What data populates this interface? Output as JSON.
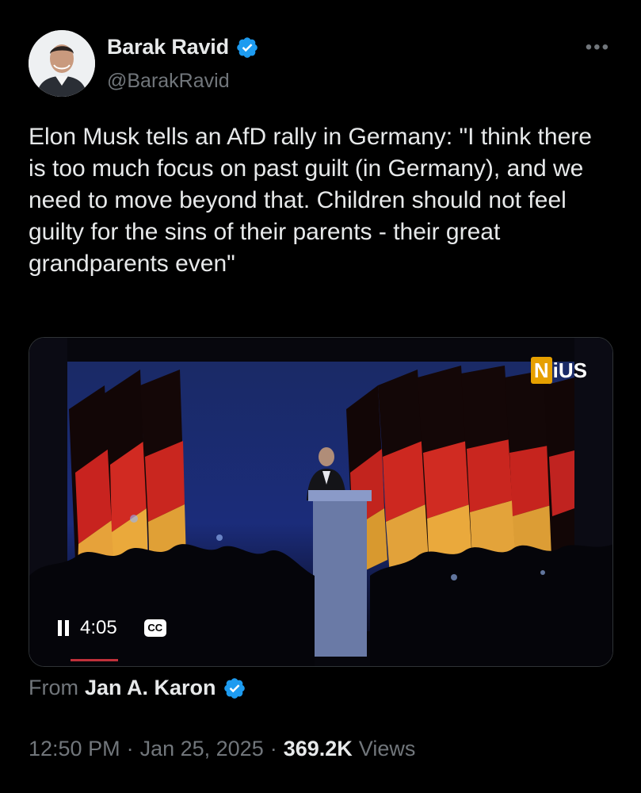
{
  "author": {
    "display_name": "Barak Ravid",
    "handle": "@BarakRavid",
    "verified": true
  },
  "more_icon": "more-horizontal-icon",
  "tweet": {
    "text": "Elon Musk tells an AfD rally in Germany: \"I think there is too much focus on past guilt (in Germany), and we need to move beyond that. Children should not feel guilty for the sins of their parents - their great grandparents even\""
  },
  "video": {
    "watermark_n": "N",
    "watermark_rest": "iUS",
    "state": "playing",
    "time": "4:05",
    "cc_label": "CC"
  },
  "source": {
    "prefix": "From",
    "name": "Jan A. Karon",
    "verified": true
  },
  "meta": {
    "time": "12:50 PM",
    "separator": "·",
    "date": "Jan 25, 2025",
    "views_count": "369.2K",
    "views_label": "Views"
  },
  "colors": {
    "background": "#000000",
    "text_primary": "#e7e9ea",
    "text_secondary": "#71767b",
    "verified_blue": "#1d9bf0"
  }
}
